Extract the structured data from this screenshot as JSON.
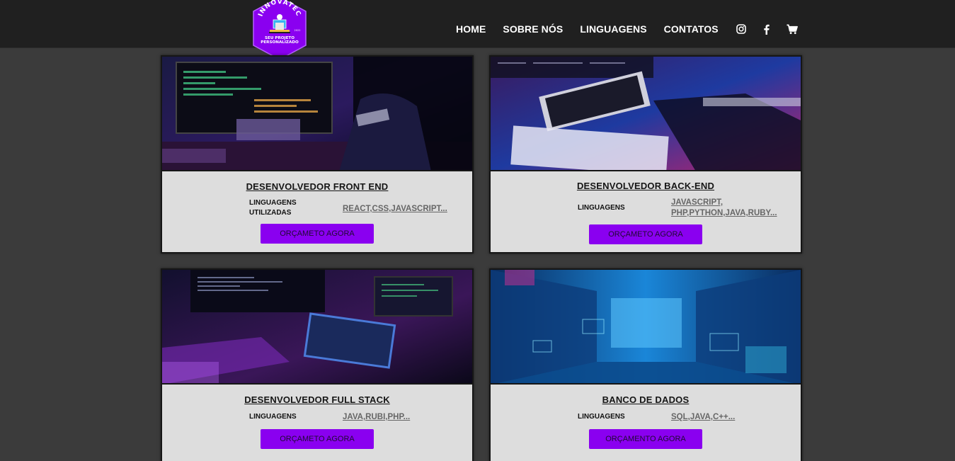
{
  "header": {
    "logo": {
      "arc_text": "INNOVATEC",
      "line1": "SEU PROJETO",
      "line2": "PERSONALIZADO",
      "small": "2022",
      "color": "#8a00f0"
    },
    "nav": [
      {
        "label": "HOME"
      },
      {
        "label": "SOBRE NÓS"
      },
      {
        "label": "LINGUAGENS"
      },
      {
        "label": "CONTATOS"
      }
    ],
    "icons": [
      "instagram-icon",
      "facebook-icon",
      "cart-icon"
    ]
  },
  "cards": [
    {
      "title": "DESENVOLVEDOR FRONT END",
      "languages_label": "LINGUAGENS UTILIZADAS",
      "languages_value": "REACT,CSS,JAVASCRIPT...",
      "button": "ORÇAMETO AGORA"
    },
    {
      "title": "DESENVOLVEDOR BACK-END",
      "languages_label": "LINGUAGENS",
      "languages_value": "JAVASCRIPT, PHP,PYTHON,JAVA,RUBY...",
      "button": "ORÇAMETO AGORA"
    },
    {
      "title": "DESENVOLVEDOR FULL STACK",
      "languages_label": "LINGUAGENS",
      "languages_value": "JAVA,RUBI,PHP...",
      "button": "ORÇAMETO AGORA"
    },
    {
      "title": "BANCO DE DADOS",
      "languages_label": "LINGUAGENS",
      "languages_value": "SQL,JAVA,C++...",
      "button": "ORÇAMENTO AGORA"
    }
  ],
  "colors": {
    "accent": "#8a00f0",
    "header_bg": "#202020",
    "page_bg": "#3b3b3b",
    "card_bg": "#dddddd"
  }
}
